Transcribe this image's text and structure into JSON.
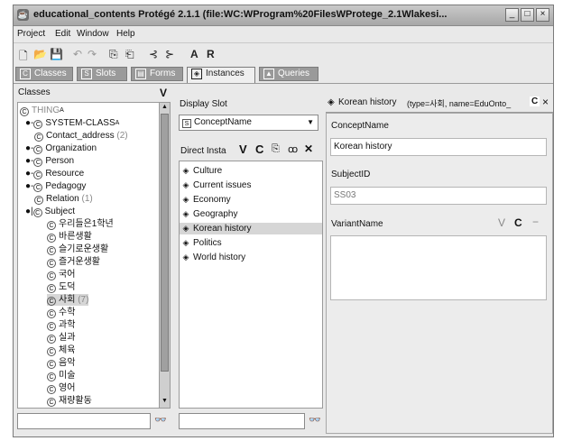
{
  "window": {
    "title": "educational_contents  Protégé 2.1.1     (file:WC:WProgram%20FilesWProtege_2.1Wlakesi...",
    "minimize": "_",
    "maximize": "□",
    "close": "×"
  },
  "menu": [
    "Project",
    "Edit",
    "Window",
    "Help"
  ],
  "toolbar": {
    "new": "🗋",
    "open": "📂",
    "save": "💾",
    "undo": "↶",
    "redo": "↷",
    "copy": "⎘",
    "paste": "⎗",
    "tool1": "⊰",
    "tool2": "⊱",
    "a_label": "A",
    "r_label": "R"
  },
  "tabs": [
    {
      "label": "Classes",
      "icon": "C"
    },
    {
      "label": "Slots",
      "icon": "S"
    },
    {
      "label": "Forms",
      "icon": "▤"
    },
    {
      "label": "Instances",
      "icon": "◈"
    },
    {
      "label": "Queries",
      "icon": "▲"
    }
  ],
  "classes_pane": {
    "header": "Classes",
    "header_btn_v": "V",
    "thing": "THING",
    "thing_sup": "A",
    "items": [
      {
        "label": "SYSTEM-CLASS",
        "suffix": "A"
      },
      {
        "label": "Contact_address",
        "count": "(2)"
      },
      {
        "label": "Organization",
        "count": ""
      },
      {
        "label": "Person",
        "count": ""
      },
      {
        "label": "Resource",
        "count": ""
      },
      {
        "label": "Pedagogy",
        "count": ""
      },
      {
        "label": "Relation",
        "count": "(1)"
      },
      {
        "label": "Subject",
        "count": ""
      }
    ],
    "subject_children": [
      {
        "label": "우리들은1학년",
        "count": ""
      },
      {
        "label": "바른생활",
        "count": ""
      },
      {
        "label": "슬기로운생활",
        "count": ""
      },
      {
        "label": "즐거운생활",
        "count": ""
      },
      {
        "label": "국어",
        "count": ""
      },
      {
        "label": "도덕",
        "count": ""
      },
      {
        "label": "사회",
        "count": "(7)"
      },
      {
        "label": "수학",
        "count": ""
      },
      {
        "label": "과학",
        "count": ""
      },
      {
        "label": "실과",
        "count": ""
      },
      {
        "label": "체육",
        "count": ""
      },
      {
        "label": "음악",
        "count": ""
      },
      {
        "label": "미술",
        "count": ""
      },
      {
        "label": "영어",
        "count": ""
      },
      {
        "label": "재량활동",
        "count": ""
      }
    ],
    "search_icon": "👓"
  },
  "display_slot": {
    "header": "Display Slot",
    "value": "ConceptName",
    "icon": "S"
  },
  "direct_instances": {
    "header": "Direct Insta",
    "btn_v": "V",
    "btn_c": "C",
    "btn_copy": "⎘",
    "btn_ref": "ꝏ",
    "btn_delete": "✕",
    "items": [
      "Culture",
      "Current issues",
      "Economy",
      "Geography",
      "Korean history",
      "Politics",
      "World history"
    ],
    "selected": "Korean history",
    "search_icon": "👓"
  },
  "instance_form": {
    "header_name": "Korean history",
    "header_type": "(type=사회, name=EduOnto_",
    "header_btn_c": "C",
    "header_close": "×",
    "concept_label": "ConceptName",
    "concept_value": "Korean history",
    "subject_label": "SubjectID",
    "subject_value": "SS03",
    "variant_label": "VariantName",
    "variant_btn_v": "V",
    "variant_btn_c": "C",
    "variant_btn_minus": "−"
  }
}
